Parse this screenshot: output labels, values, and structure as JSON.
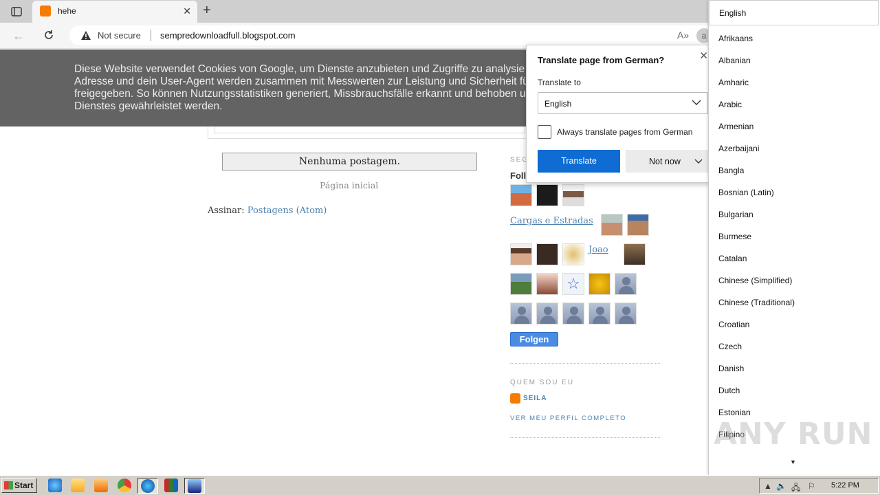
{
  "browser": {
    "tab": {
      "title": "hehe",
      "favicon": "blogger-icon"
    },
    "address": {
      "security": "Not secure",
      "url": "sempredownloadfull.blogspot.com",
      "profile_initial": "a"
    }
  },
  "page": {
    "cookie_text": "Diese Website verwendet Cookies von Google, um Dienste anzubieten und Zugriffe zu analysie\nAdresse und dein User-Agent werden zusammen mit Messwerten zur Leistung und Sicherheit fü\nfreigegeben. So können Nutzungsstatistiken generiert, Missbrauchsfälle erkannt und behoben un\nDienstes gewährleistet werden.",
    "no_posts": "Nenhuma postagem.",
    "home_link": "Página inicial",
    "subscribe_label": "Assinar:",
    "subscribe_link": "Postagens (Atom)",
    "sidebar": {
      "followers_heading": "SEG",
      "followers_title": "Foll",
      "image_link_1": "Cargas e Estradas",
      "image_link_2": "Joao",
      "follow_button": "Folgen",
      "about_heading": "QUEM SOU EU",
      "author": "SEILA",
      "profile_link": "VER MEU PERFIL COMPLETO"
    }
  },
  "translate_popup": {
    "title": "Translate page from German?",
    "translate_to_label": "Translate to",
    "selected_language": "English",
    "always_translate": "Always translate pages from German",
    "translate_button": "Translate",
    "not_now_button": "Not now"
  },
  "language_list": {
    "selected": "English",
    "items": [
      "Afrikaans",
      "Albanian",
      "Amharic",
      "Arabic",
      "Armenian",
      "Azerbaijani",
      "Bangla",
      "Bosnian (Latin)",
      "Bulgarian",
      "Burmese",
      "Catalan",
      "Chinese (Simplified)",
      "Chinese (Traditional)",
      "Croatian",
      "Czech",
      "Danish",
      "Dutch",
      "Estonian",
      "Filipino"
    ]
  },
  "watermark": "ANY RUN",
  "taskbar": {
    "start_label": "Start",
    "clock": "5:22 PM"
  }
}
